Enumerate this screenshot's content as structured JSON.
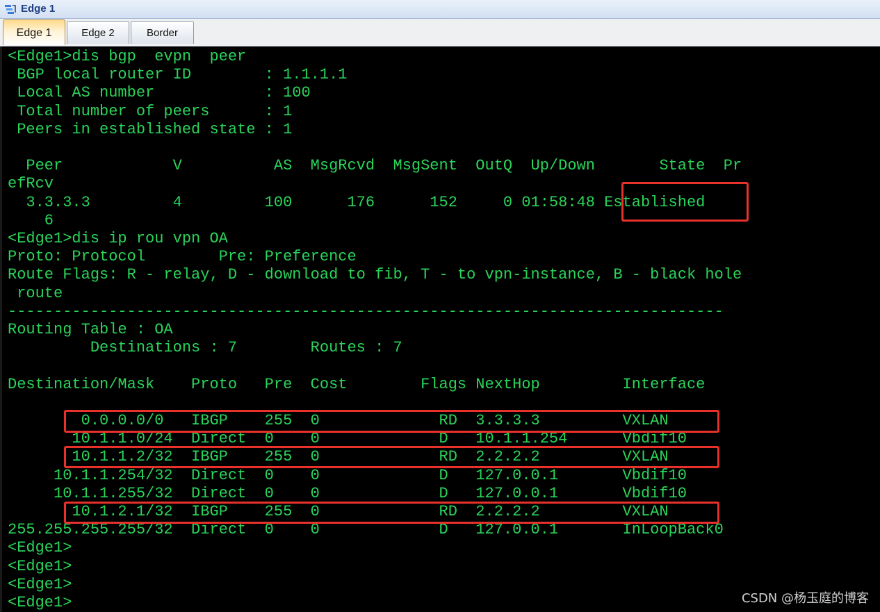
{
  "window": {
    "title": "Edge 1",
    "icon": "network-device-icon"
  },
  "tabs": [
    {
      "label": "Edge 1",
      "active": true
    },
    {
      "label": "Edge 2",
      "active": false
    },
    {
      "label": "Border",
      "active": false
    }
  ],
  "terminal": {
    "lines": [
      "<Edge1>dis bgp  evpn  peer",
      " BGP local router ID        : 1.1.1.1",
      " Local AS number            : 100",
      " Total number of peers      : 1",
      " Peers in established state : 1",
      "",
      "  Peer            V          AS  MsgRcvd  MsgSent  OutQ  Up/Down       State  Pr",
      "efRcv",
      "  3.3.3.3         4         100      176      152     0 01:58:48 Established",
      "    6",
      "<Edge1>dis ip rou vpn OA",
      "Proto: Protocol        Pre: Preference",
      "Route Flags: R - relay, D - download to fib, T - to vpn-instance, B - black hole",
      " route",
      "------------------------------------------------------------------------------",
      "Routing Table : OA",
      "         Destinations : 7        Routes : 7",
      "",
      "Destination/Mask    Proto   Pre  Cost        Flags NextHop         Interface",
      "",
      "        0.0.0.0/0   IBGP    255  0             RD  3.3.3.3         VXLAN",
      "       10.1.1.0/24  Direct  0    0             D   10.1.1.254      Vbdif10",
      "       10.1.1.2/32  IBGP    255  0             RD  2.2.2.2         VXLAN",
      "     10.1.1.254/32  Direct  0    0             D   127.0.0.1       Vbdif10",
      "     10.1.1.255/32  Direct  0    0             D   127.0.0.1       Vbdif10",
      "       10.1.2.1/32  IBGP    255  0             RD  2.2.2.2         VXLAN",
      "255.255.255.255/32  Direct  0    0             D   127.0.0.1       InLoopBack0",
      "<Edge1>",
      "<Edge1>",
      "<Edge1>",
      "<Edge1>"
    ]
  },
  "watermark": "CSDN @杨玉庭的博客",
  "colors": {
    "terminal_text": "#2bd45a",
    "terminal_bg": "#000000",
    "highlight_box": "#e8312b",
    "active_tab": "#ffd98a"
  }
}
